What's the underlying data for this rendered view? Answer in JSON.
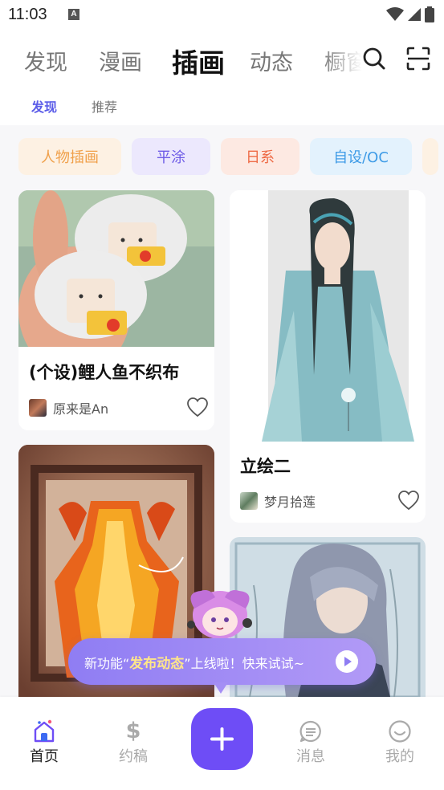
{
  "status_bar": {
    "time": "11:03",
    "notification_glyph": "A"
  },
  "top_tabs": [
    {
      "label": "发现",
      "active": false
    },
    {
      "label": "漫画",
      "active": false
    },
    {
      "label": "插画",
      "active": true
    },
    {
      "label": "动态",
      "active": false
    },
    {
      "label": "橱窗",
      "active": false
    }
  ],
  "sub_tabs": [
    {
      "label": "发现",
      "active": true
    },
    {
      "label": "推荐",
      "active": false
    }
  ],
  "chips": [
    {
      "label": "人物插画",
      "bg": "#fdf1e3",
      "fg": "#f0a04a"
    },
    {
      "label": "平涂",
      "bg": "#ece8fd",
      "fg": "#6d5ae6"
    },
    {
      "label": "日系",
      "bg": "#fde9e2",
      "fg": "#ee6a45"
    },
    {
      "label": "自设/OC",
      "bg": "#e3f2fd",
      "fg": "#3e9be6"
    }
  ],
  "cards": [
    {
      "title": "(个设)鲤人鱼不织布",
      "author": "原来是An",
      "liked": false
    },
    {
      "title": "立绘二",
      "author": "梦月拾莲",
      "liked": false
    },
    {
      "title": "",
      "author": ""
    },
    {
      "title": "",
      "author": ""
    }
  ],
  "toast": {
    "prefix": "新功能“",
    "highlight": "发布动态",
    "suffix": "”上线啦！快来试试~"
  },
  "bottom_nav": {
    "home": "首页",
    "commission": "约稿",
    "messages": "消息",
    "mine": "我的",
    "commission_symbol": "$"
  },
  "colors": {
    "accent": "#6e4df6",
    "subtab_active": "#5b5ce8",
    "toast_highlight": "#ffe68a"
  },
  "icons": [
    "search-icon",
    "scan-icon",
    "heart-icon",
    "home-icon",
    "dollar-icon",
    "message-icon",
    "smile-icon",
    "plus-icon",
    "play-icon"
  ]
}
